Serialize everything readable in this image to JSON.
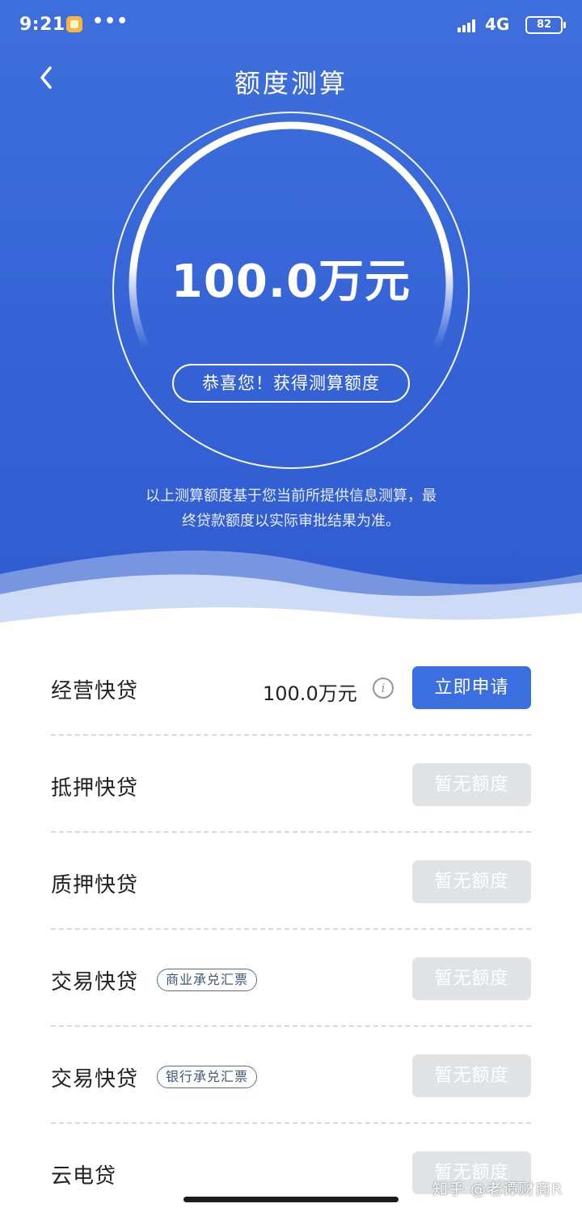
{
  "status_bar": {
    "time": "9:21",
    "dots": "•••",
    "network": "4G",
    "battery": "82"
  },
  "header": {
    "title": "额度测算",
    "back_icon": "chevron-left-icon"
  },
  "result": {
    "amount": "100.0万元",
    "congrats": "恭喜您！获得测算额度",
    "disclaimer_line1": "以上测算额度基于您当前所提供信息测算，最",
    "disclaimer_line2": "终贷款额度以实际审批结果为准。"
  },
  "products": [
    {
      "name": "经营快贷",
      "tag": "",
      "amount": "100.0万元",
      "button": "立即申请",
      "available": true
    },
    {
      "name": "抵押快贷",
      "tag": "",
      "amount": "",
      "button": "暂无额度",
      "available": false
    },
    {
      "name": "质押快贷",
      "tag": "",
      "amount": "",
      "button": "暂无额度",
      "available": false
    },
    {
      "name": "交易快贷",
      "tag": "商业承兑汇票",
      "amount": "",
      "button": "暂无额度",
      "available": false
    },
    {
      "name": "交易快贷",
      "tag": "银行承兑汇票",
      "amount": "",
      "button": "暂无额度",
      "available": false
    },
    {
      "name": "云电贷",
      "tag": "",
      "amount": "",
      "button": "暂无额度",
      "available": false
    }
  ],
  "watermark": "知乎 @老谭财商R",
  "colors": {
    "brand_blue": "#3b6fe0",
    "hero_blue": "#3563d6",
    "disabled_gray": "#e1e2e5"
  }
}
